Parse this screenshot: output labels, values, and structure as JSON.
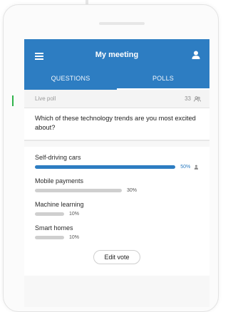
{
  "app": {
    "title": "My meeting"
  },
  "tabs": [
    {
      "label": "QUESTIONS",
      "active": false
    },
    {
      "label": "POLLS",
      "active": true
    }
  ],
  "poll": {
    "status_label": "Live poll",
    "participant_count": "33",
    "question": "Which of these technology trends are you most excited about?",
    "options": [
      {
        "label": "Self-driving cars",
        "percent": 50,
        "percent_label": "50%",
        "selected": true
      },
      {
        "label": "Mobile payments",
        "percent": 30,
        "percent_label": "30%",
        "selected": false
      },
      {
        "label": "Machine learning",
        "percent": 10,
        "percent_label": "10%",
        "selected": false
      },
      {
        "label": "Smart homes",
        "percent": 10,
        "percent_label": "10%",
        "selected": false
      }
    ],
    "edit_vote_label": "Edit vote"
  },
  "colors": {
    "primary": "#2d7dc2",
    "bar_inactive": "#cfcfcf",
    "accent_green": "#2fb34a"
  },
  "icons": {
    "menu": "hamburger-menu-icon",
    "profile": "person-icon",
    "participants": "participants-icon",
    "voter": "voter-icon"
  }
}
